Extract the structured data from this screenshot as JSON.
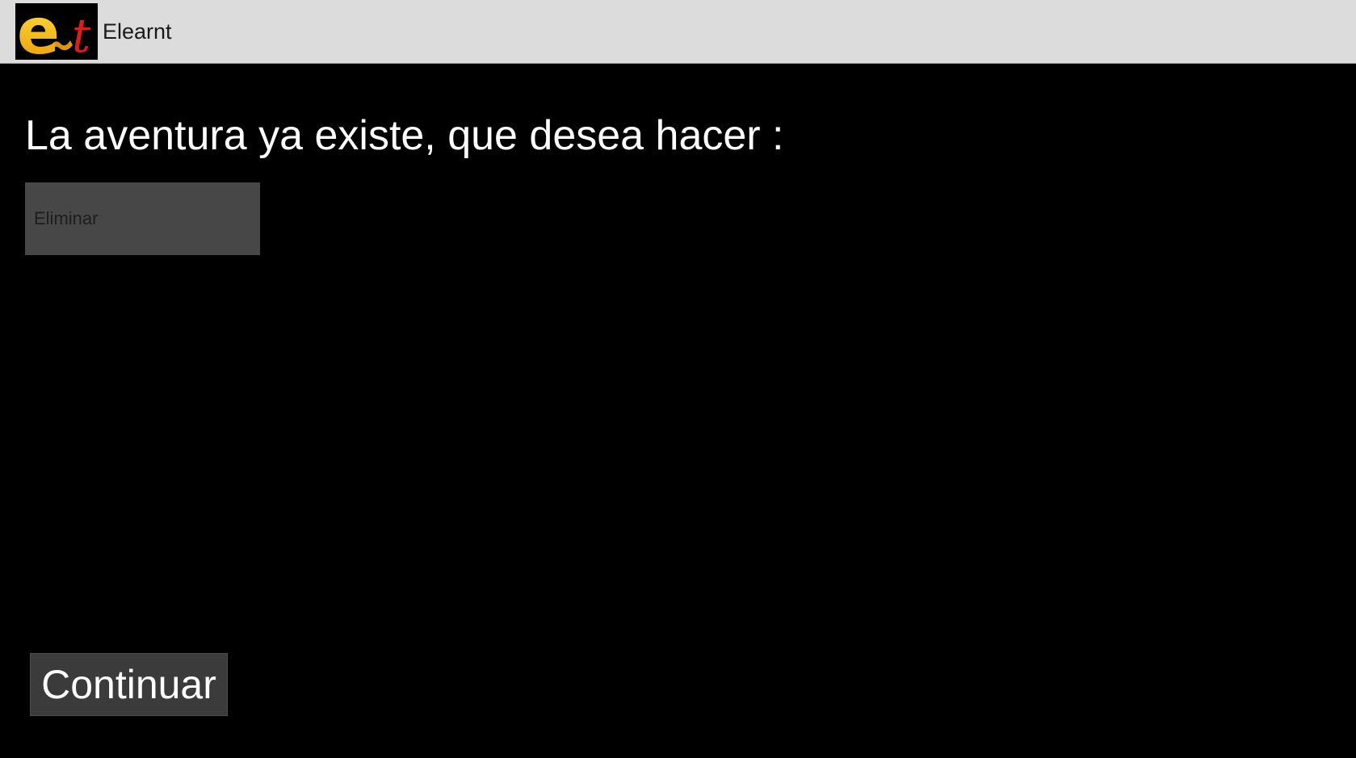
{
  "app_bar": {
    "title": "Elearnt",
    "icon": "elearnt-logo-icon"
  },
  "main": {
    "prompt": "La aventura ya existe, que desea hacer :",
    "action_select": {
      "selected_value": "Eliminar"
    },
    "continue_label": "Continuar"
  },
  "colors": {
    "app_bar_bg": "#dcdcdc",
    "content_bg": "#000000",
    "select_bg": "#474747",
    "button_bg": "#3b3b3b",
    "logo_yellow": "#f5b800",
    "logo_red": "#d81e1e"
  }
}
